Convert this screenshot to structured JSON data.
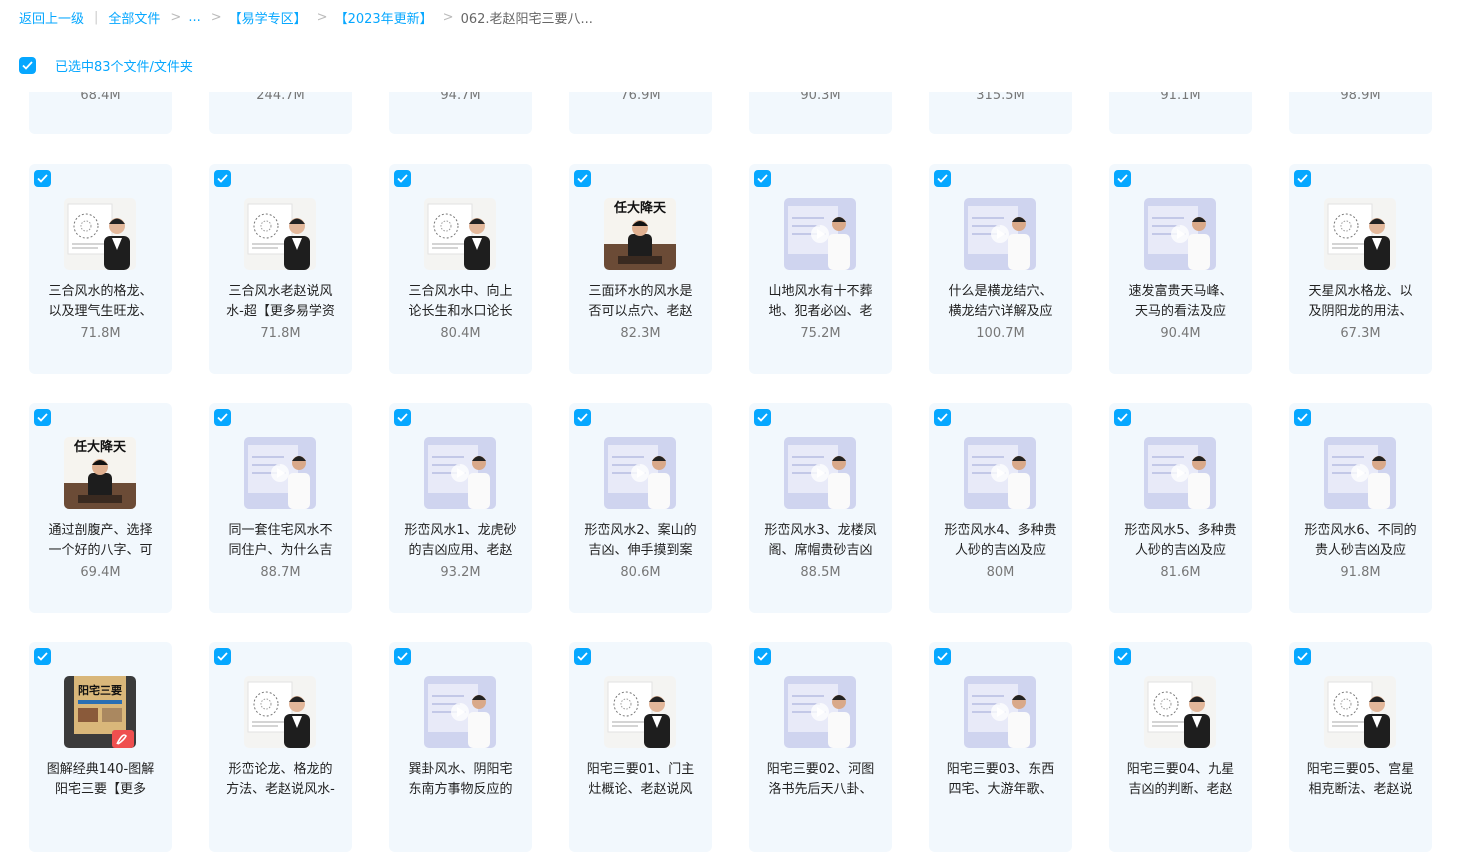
{
  "breadcrumb": {
    "back": "返回上一级",
    "all": "全部文件",
    "ellipsis": "...",
    "crumb1": "【易学专区】",
    "crumb2": "【2023年更新】",
    "current": "062.老赵阳宅三要八..."
  },
  "selection": {
    "label": "已选中83个文件/文件夹",
    "checked": true
  },
  "partial_row": [
    "68.4M",
    "244.7M",
    "94.7M",
    "76.9M",
    "90.3M",
    "315.5M",
    "91.1M",
    "98.9M"
  ],
  "files": [
    {
      "line1": "三合风水的格龙、",
      "line2": "以及理气生旺龙、",
      "size": "71.8M",
      "thumb": "board"
    },
    {
      "line1": "三合风水老赵说风",
      "line2": "水-超【更多易学资",
      "size": "71.8M",
      "thumb": "board"
    },
    {
      "line1": "三合风水中、向上",
      "line2": "论长生和水口论长",
      "size": "80.4M",
      "thumb": "board"
    },
    {
      "line1": "三面环水的风水是",
      "line2": "否可以点穴、老赵",
      "size": "82.3M",
      "thumb": "calligraphy"
    },
    {
      "line1": "山地风水有十不葬",
      "line2": "地、犯者必凶、老",
      "size": "75.2M",
      "thumb": "video"
    },
    {
      "line1": "什么是横龙结穴、",
      "line2": "横龙结穴详解及应",
      "size": "100.7M",
      "thumb": "video"
    },
    {
      "line1": "速发富贵天马峰、",
      "line2": "天马的看法及应",
      "size": "90.4M",
      "thumb": "video"
    },
    {
      "line1": "天星风水格龙、以",
      "line2": "及阴阳龙的用法、",
      "size": "67.3M",
      "thumb": "board"
    },
    {
      "line1": "通过剖腹产、选择",
      "line2": "一个好的八字、可",
      "size": "69.4M",
      "thumb": "calligraphy"
    },
    {
      "line1": "同一套住宅风水不",
      "line2": "同住户、为什么吉",
      "size": "88.7M",
      "thumb": "video"
    },
    {
      "line1": "形峦风水1、龙虎砂",
      "line2": "的吉凶应用、老赵",
      "size": "93.2M",
      "thumb": "video"
    },
    {
      "line1": "形峦风水2、案山的",
      "line2": "吉凶、伸手摸到案",
      "size": "80.6M",
      "thumb": "video"
    },
    {
      "line1": "形峦风水3、龙楼凤",
      "line2": "阁、席帽贵砂吉凶",
      "size": "88.5M",
      "thumb": "video"
    },
    {
      "line1": "形峦风水4、多种贵",
      "line2": "人砂的吉凶及应",
      "size": "80M",
      "thumb": "video"
    },
    {
      "line1": "形峦风水5、多种贵",
      "line2": "人砂的吉凶及应",
      "size": "81.6M",
      "thumb": "video"
    },
    {
      "line1": "形峦风水6、不同的",
      "line2": "贵人砂吉凶及应",
      "size": "91.8M",
      "thumb": "video"
    },
    {
      "line1": "图解经典140-图解",
      "line2": "阳宅三要【更多",
      "size": "",
      "thumb": "pdf",
      "pdf_title": "阳宅三要"
    },
    {
      "line1": "形峦论龙、格龙的",
      "line2": "方法、老赵说风水-",
      "size": "",
      "thumb": "board"
    },
    {
      "line1": "巽卦风水、阴阳宅",
      "line2": "东南方事物反应的",
      "size": "",
      "thumb": "video"
    },
    {
      "line1": "阳宅三要01、门主",
      "line2": "灶概论、老赵说风",
      "size": "",
      "thumb": "board"
    },
    {
      "line1": "阳宅三要02、河图",
      "line2": "洛书先后天八卦、",
      "size": "",
      "thumb": "video"
    },
    {
      "line1": "阳宅三要03、东西",
      "line2": "四宅、大游年歌、",
      "size": "",
      "thumb": "video"
    },
    {
      "line1": "阳宅三要04、九星",
      "line2": "吉凶的判断、老赵",
      "size": "",
      "thumb": "board"
    },
    {
      "line1": "阳宅三要05、宫星",
      "line2": "相克断法、老赵说",
      "size": "",
      "thumb": "board"
    }
  ],
  "calligraphy_text": "任大降天"
}
